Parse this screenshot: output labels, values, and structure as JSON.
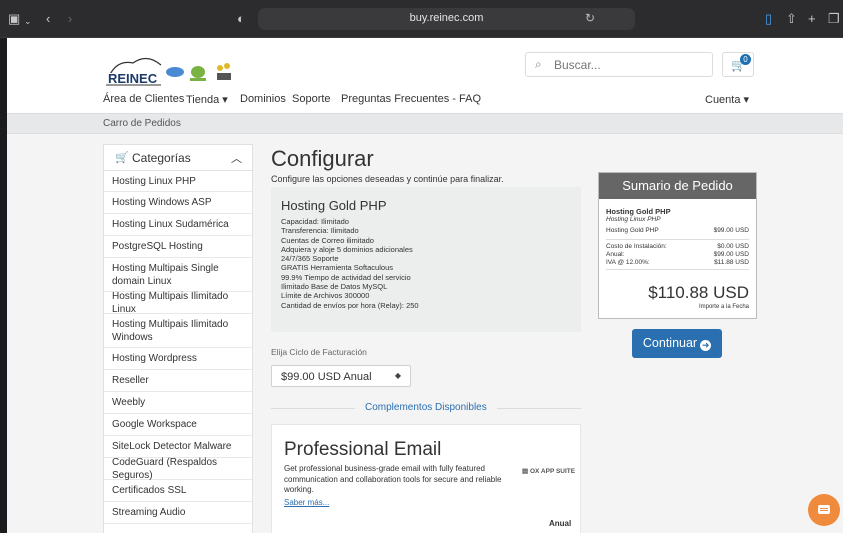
{
  "browser": {
    "url": "buy.reinec.com"
  },
  "header": {
    "logo_text": "REINEC",
    "search_placeholder": "Buscar...",
    "cart_count": "0"
  },
  "nav": {
    "items": [
      "Área de Clientes",
      "Tienda",
      "Dominios",
      "Soporte",
      "Preguntas Frecuentes - FAQ"
    ],
    "account": "Cuenta"
  },
  "breadcrumb": "Carro de Pedidos",
  "sidebar": {
    "title": "Categorías",
    "items": [
      "Hosting Linux PHP",
      "Hosting Windows ASP",
      "Hosting Linux Sudamérica",
      "PostgreSQL Hosting",
      "Hosting Multipais Single domain Linux",
      "Hosting Multipais Ilimitado Linux",
      "Hosting Multipais Ilimitado Windows",
      "Hosting Wordpress",
      "Reseller",
      "Weebly",
      "Google Workspace",
      "SiteLock Detector Malware",
      "CodeGuard (Respaldos Seguros)",
      "Certificados SSL",
      "Streaming Audio"
    ]
  },
  "main": {
    "title": "Configurar",
    "subtitle": "Configure las opciones deseadas y continúe para finalizar.",
    "product": {
      "name": "Hosting Gold PHP",
      "features": [
        "Capacidad: Ilimitado",
        "Transferencia: Ilimitado",
        "Cuentas de Correo ilimitado",
        "Adquiera y aloje 5 dominios adicionales",
        "24/7/365 Soporte",
        "GRATIS Herramienta Softaculous",
        "99.9% Tiempo de actividad del servicio",
        "Ilimitado Base de Datos MySQL",
        "Límite de Archivos 300000",
        "Cantidad de envíos por hora (Relay): 250"
      ]
    },
    "billing_label": "Elija Ciclo de Facturación",
    "billing_value": "$99.00 USD Anual",
    "addons_label": "Complementos Disponibles",
    "addon": {
      "title": "Professional Email",
      "description": "Get professional business-grade email with fully featured communication and collaboration tools for secure and reliable working.",
      "more": "Saber más...",
      "brand": "OX APP SUITE",
      "period": "Anual"
    }
  },
  "summary": {
    "title": "Sumario de Pedido",
    "product": "Hosting Gold PHP",
    "category": "Hosting Linux PHP",
    "line_label": "Hosting Gold PHP",
    "line_value": "$99.00 USD",
    "setup_label": "Costo de Instalación:",
    "setup_value": "$0.00 USD",
    "annual_label": "Anual:",
    "annual_value": "$99.00 USD",
    "tax_label": "IVA @ 12.00%:",
    "tax_value": "$11.88 USD",
    "total": "$110.88 USD",
    "total_note": "Importe a la Fecha"
  },
  "continue_label": "Continuar",
  "colors": {
    "accent": "#2a6fb0",
    "summary_header": "#666666",
    "chat": "#f08a3c"
  }
}
